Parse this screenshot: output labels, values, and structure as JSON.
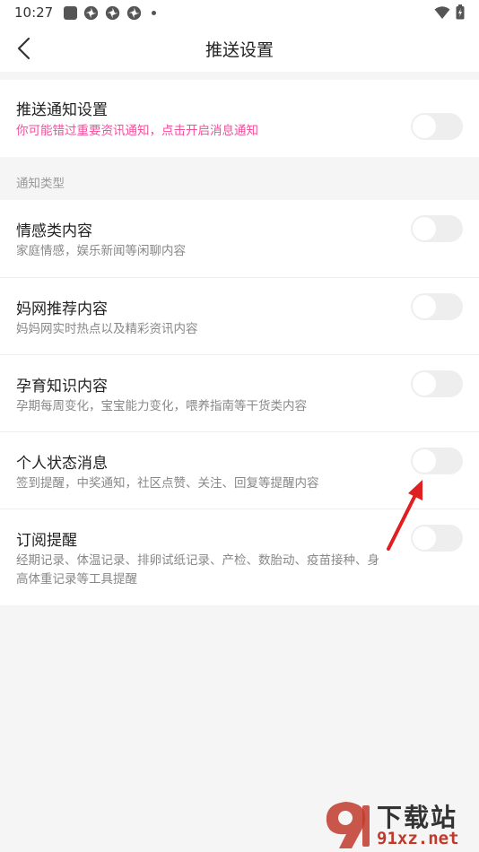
{
  "status_bar": {
    "time": "10:27"
  },
  "header": {
    "title": "推送设置"
  },
  "push": {
    "title": "推送通知设置",
    "subtitle": "你可能错过重要资讯通知，点击开启消息通知"
  },
  "section_label": "通知类型",
  "items": [
    {
      "title": "情感类内容",
      "subtitle": "家庭情感，娱乐新闻等闲聊内容"
    },
    {
      "title": "妈网推荐内容",
      "subtitle": "妈妈网实时热点以及精彩资讯内容"
    },
    {
      "title": "孕育知识内容",
      "subtitle": "孕期每周变化，宝宝能力变化，喂养指南等干货类内容"
    },
    {
      "title": "个人状态消息",
      "subtitle": "签到提醒，中奖通知，社区点赞、关注、回复等提醒内容"
    },
    {
      "title": "订阅提醒",
      "subtitle": "经期记录、体温记录、排卵试纸记录、产检、数胎动、疫苗接种、身高体重记录等工具提醒"
    }
  ],
  "watermark": {
    "text": "下载站",
    "url": "91xz.net"
  },
  "colors": {
    "accent_pink": "#f0509b",
    "annotation_red": "#e02020"
  }
}
